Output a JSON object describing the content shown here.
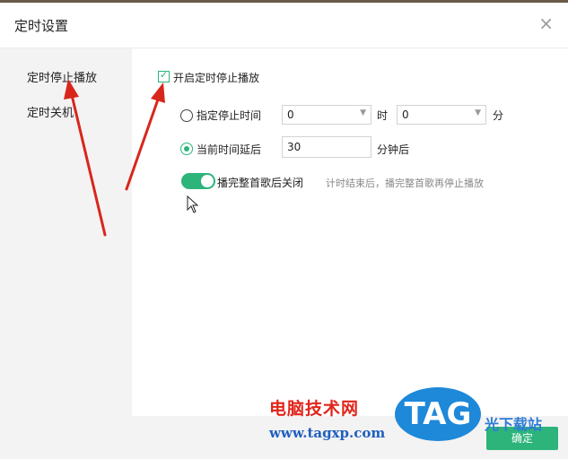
{
  "dialog": {
    "title": "定时设置",
    "close_icon": "×"
  },
  "sidebar": {
    "items": [
      {
        "label": "定时停止播放"
      },
      {
        "label": "定时关机"
      }
    ]
  },
  "main": {
    "enable_checkbox": {
      "label": "开启定时停止播放",
      "checked": true
    },
    "option_specified": {
      "label": "指定停止时间",
      "selected": false,
      "hour_value": "0",
      "hour_unit": "时",
      "minute_value": "0",
      "minute_unit": "分"
    },
    "option_delay": {
      "label": "当前时间延后",
      "selected": true,
      "value": "30",
      "unit": "分钟后"
    },
    "finish_song": {
      "label": "播完整首歌后关闭",
      "on": true,
      "hint": "计时结束后，播完整首歌再停止播放"
    }
  },
  "footer": {
    "ok_label": "确定"
  },
  "watermark": {
    "site_name": "电脑技术网",
    "url": "www.tagxp.com",
    "badge": "TAG",
    "site_name2": "光下载站"
  },
  "colors": {
    "accent": "#2cb47b",
    "arrow": "#d9261c"
  }
}
